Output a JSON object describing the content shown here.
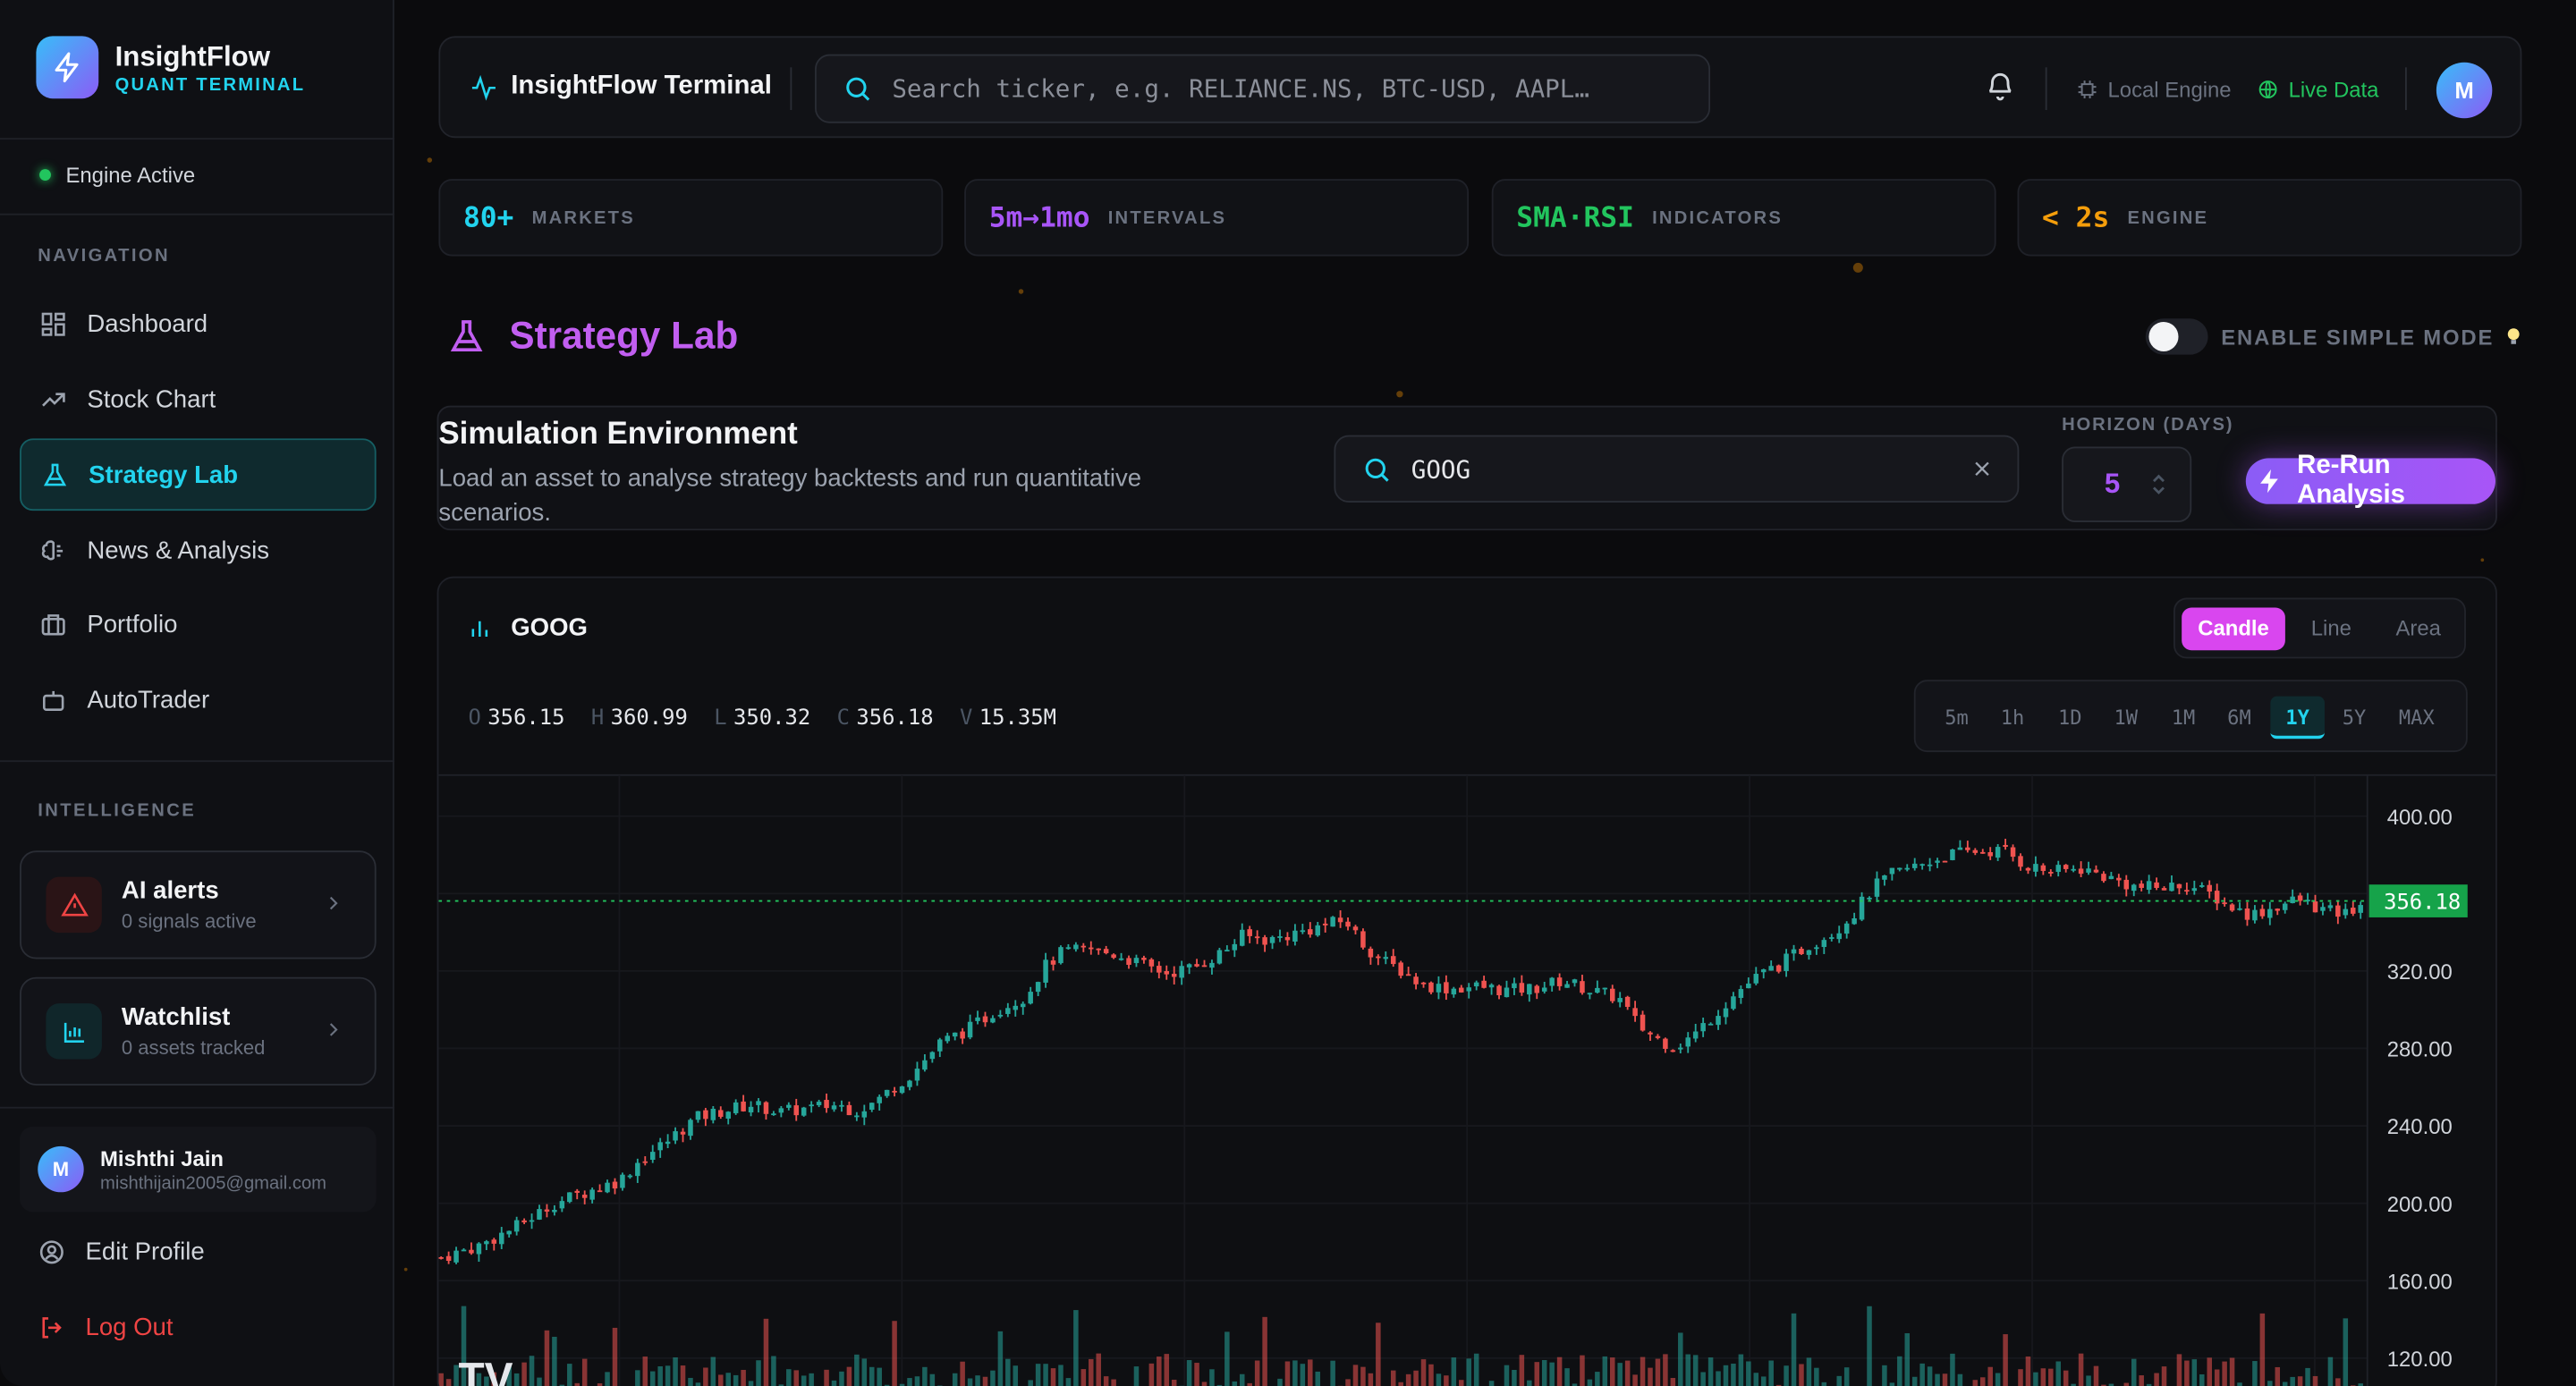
{
  "brand": {
    "name": "InsightFlow",
    "sub": "QUANT TERMINAL"
  },
  "engine_status": "Engine Active",
  "sidebar": {
    "nav_heading": "NAVIGATION",
    "items": [
      {
        "label": "Dashboard",
        "icon": "dashboard-icon"
      },
      {
        "label": "Stock Chart",
        "icon": "trend-icon"
      },
      {
        "label": "Strategy Lab",
        "icon": "flask-icon",
        "active": true
      },
      {
        "label": "News & Analysis",
        "icon": "brain-icon"
      },
      {
        "label": "Portfolio",
        "icon": "briefcase-icon"
      },
      {
        "label": "AutoTrader",
        "icon": "bot-icon"
      }
    ],
    "intel_heading": "INTELLIGENCE",
    "alerts": {
      "title": "AI alerts",
      "sub": "0 signals active"
    },
    "watchlist": {
      "title": "Watchlist",
      "sub": "0 assets tracked"
    },
    "user": {
      "initial": "M",
      "name": "Mishthi Jain",
      "email": "mishthijain2005@gmail.com"
    },
    "edit_profile": "Edit Profile",
    "logout": "Log Out"
  },
  "topbar": {
    "title": "InsightFlow Terminal",
    "search_placeholder": "Search ticker, e.g. RELIANCE.NS, BTC-USD, AAPL…",
    "local_engine": "Local Engine",
    "live_data": "Live Data",
    "avatar": "M"
  },
  "stats": [
    {
      "value": "80+",
      "label": "MARKETS",
      "color": "#22d3ee"
    },
    {
      "value": "5m→1mo",
      "label": "INTERVALS",
      "color": "#a855f7"
    },
    {
      "value": "SMA·RSI",
      "label": "INDICATORS",
      "color": "#22c55e"
    },
    {
      "value": "< 2s",
      "label": "ENGINE",
      "color": "#f59e0b"
    }
  ],
  "lab": {
    "title": "Strategy Lab",
    "simple_mode": "ENABLE SIMPLE MODE",
    "env_title": "Simulation Environment",
    "env_desc": "Load an asset to analyse strategy backtests and run quantitative scenarios.",
    "ticker": "GOOG",
    "horizon_label": "HORIZON (DAYS)",
    "horizon_value": "5",
    "rerun": "Re-Run Analysis"
  },
  "chart": {
    "symbol": "GOOG",
    "types": [
      "Candle",
      "Line",
      "Area"
    ],
    "active_type": "Candle",
    "ohlc": [
      {
        "k": "O",
        "v": "356.15"
      },
      {
        "k": "H",
        "v": "360.99"
      },
      {
        "k": "L",
        "v": "350.32"
      },
      {
        "k": "C",
        "v": "356.18"
      },
      {
        "k": "V",
        "v": "15.35M"
      }
    ],
    "timeframes": [
      "5m",
      "1h",
      "1D",
      "1W",
      "1M",
      "6M",
      "1Y",
      "5Y",
      "MAX"
    ],
    "active_timeframe": "1Y",
    "last_price_label": "356.18",
    "y_ticks": [
      "400.00",
      "320.00",
      "280.00",
      "240.00",
      "200.00",
      "160.00",
      "120.00"
    ]
  },
  "chart_data": {
    "type": "candlestick",
    "symbol": "GOOG",
    "range": "1Y",
    "ylim": [
      115,
      410
    ],
    "last_close": 356.18,
    "up_color": "#26a69a",
    "down_color": "#ef5350",
    "close_path": [
      [
        0,
        172
      ],
      [
        20,
        178
      ],
      [
        40,
        188
      ],
      [
        60,
        200
      ],
      [
        80,
        207
      ],
      [
        95,
        212
      ],
      [
        105,
        222
      ],
      [
        120,
        232
      ],
      [
        135,
        244
      ],
      [
        150,
        248
      ],
      [
        165,
        251
      ],
      [
        180,
        247
      ],
      [
        195,
        249
      ],
      [
        210,
        251
      ],
      [
        220,
        248
      ],
      [
        230,
        252
      ],
      [
        240,
        260
      ],
      [
        250,
        267
      ],
      [
        265,
        283
      ],
      [
        280,
        290
      ],
      [
        295,
        300
      ],
      [
        310,
        307
      ],
      [
        320,
        322
      ],
      [
        330,
        330
      ],
      [
        345,
        331
      ],
      [
        360,
        328
      ],
      [
        375,
        322
      ],
      [
        385,
        319
      ],
      [
        400,
        322
      ],
      [
        415,
        330
      ],
      [
        425,
        338
      ],
      [
        440,
        336
      ],
      [
        455,
        340
      ],
      [
        470,
        344
      ],
      [
        480,
        346
      ],
      [
        490,
        333
      ],
      [
        500,
        325
      ],
      [
        510,
        320
      ],
      [
        520,
        313
      ],
      [
        535,
        311
      ],
      [
        550,
        312
      ],
      [
        565,
        310
      ],
      [
        580,
        311
      ],
      [
        595,
        315
      ],
      [
        610,
        310
      ],
      [
        625,
        306
      ],
      [
        635,
        292
      ],
      [
        645,
        285
      ],
      [
        655,
        281
      ],
      [
        665,
        287
      ],
      [
        675,
        297
      ],
      [
        690,
        311
      ],
      [
        700,
        318
      ],
      [
        710,
        323
      ],
      [
        725,
        333
      ],
      [
        740,
        341
      ],
      [
        750,
        350
      ],
      [
        760,
        363
      ],
      [
        770,
        370
      ],
      [
        785,
        375
      ],
      [
        800,
        380
      ],
      [
        815,
        382
      ],
      [
        830,
        382
      ],
      [
        840,
        375
      ],
      [
        855,
        371
      ],
      [
        870,
        373
      ],
      [
        885,
        368
      ],
      [
        900,
        363
      ],
      [
        915,
        363
      ],
      [
        925,
        365
      ],
      [
        940,
        359
      ],
      [
        950,
        353
      ],
      [
        960,
        349
      ],
      [
        970,
        352
      ],
      [
        985,
        357
      ],
      [
        1000,
        351
      ],
      [
        1010,
        349
      ],
      [
        1020,
        356
      ]
    ]
  }
}
